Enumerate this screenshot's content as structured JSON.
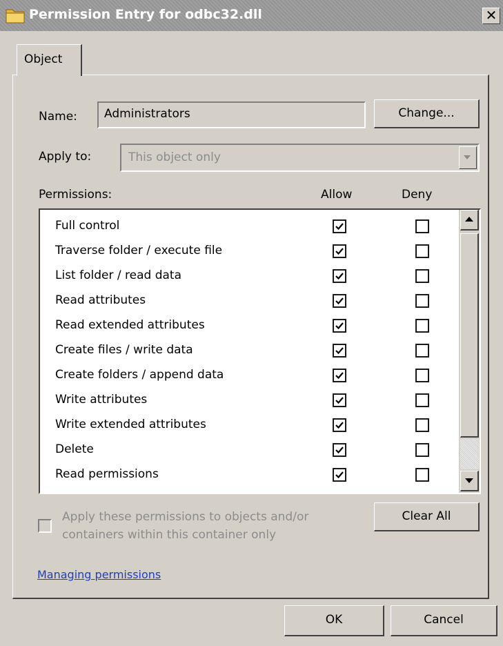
{
  "window": {
    "title": "Permission Entry for odbc32.dll",
    "close_glyph": "✕"
  },
  "tabs": [
    {
      "label": "Object"
    }
  ],
  "name": {
    "label": "Name:",
    "value": "Administrators",
    "change_button": "Change..."
  },
  "apply_to": {
    "label": "Apply to:",
    "value": "This object only"
  },
  "permissions": {
    "label": "Permissions:",
    "allow_header": "Allow",
    "deny_header": "Deny",
    "rows": [
      {
        "label": "Full control",
        "allow": true,
        "deny": false
      },
      {
        "label": "Traverse folder / execute file",
        "allow": true,
        "deny": false
      },
      {
        "label": "List folder / read data",
        "allow": true,
        "deny": false
      },
      {
        "label": "Read attributes",
        "allow": true,
        "deny": false
      },
      {
        "label": "Read extended attributes",
        "allow": true,
        "deny": false
      },
      {
        "label": "Create files / write data",
        "allow": true,
        "deny": false
      },
      {
        "label": "Create folders / append data",
        "allow": true,
        "deny": false
      },
      {
        "label": "Write attributes",
        "allow": true,
        "deny": false
      },
      {
        "label": "Write extended attributes",
        "allow": true,
        "deny": false
      },
      {
        "label": "Delete",
        "allow": true,
        "deny": false
      },
      {
        "label": "Read permissions",
        "allow": true,
        "deny": false
      }
    ]
  },
  "apply_inherit": {
    "line1": "Apply these permissions to objects and/or",
    "line2": "containers within this container only",
    "checked": false
  },
  "clear_all_button": "Clear All",
  "managing_link": "Managing permissions",
  "footer": {
    "ok": "OK",
    "cancel": "Cancel"
  },
  "colors": {
    "face": "#d4d0c8",
    "title_bar": "#9a9a9a",
    "link": "#1f3fbf",
    "disabled_text": "#8c8c8c"
  },
  "icons": {
    "title": "folder-icon",
    "close": "close-icon",
    "scroll_up": "up-arrow-icon",
    "scroll_down": "down-arrow-icon",
    "dropdown": "chevron-down-icon"
  }
}
